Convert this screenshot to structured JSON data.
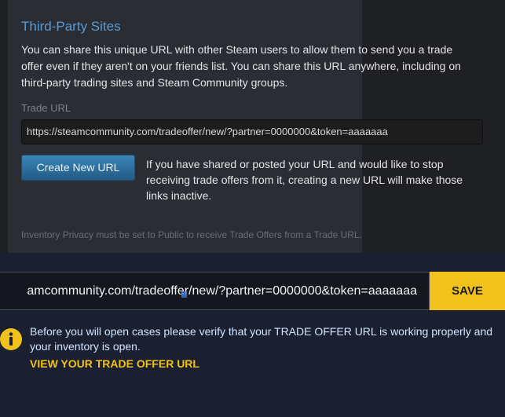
{
  "steam": {
    "section_title": "Third-Party Sites",
    "description": "You can share this unique URL with other Steam users to allow them to send you a trade offer even if they aren't on your friends list. You can share this URL anywhere, including on third-party trading sites and Steam Community groups.",
    "trade_url_label": "Trade URL",
    "trade_url_value": "https://steamcommunity.com/tradeoffer/new/?partner=0000000&token=aaaaaaa",
    "create_button": "Create New URL",
    "create_note": "If you have shared or posted your URL and would like to stop receiving trade offers from it, creating a new URL will make those links inactive.",
    "privacy_note": "Inventory Privacy must be set to Public to receive Trade Offers from a Trade URL."
  },
  "site": {
    "url_value_visible": "amcommunity.com/tradeoffer/new/?partner=0000000&token=aaaaaaa",
    "save_button": "SAVE",
    "info_icon": "info-icon",
    "warning": "Before you will open cases please verify that your TRADE OFFER URL is working properly and your inventory is open.",
    "view_link": "VIEW YOUR TRADE OFFER URL"
  },
  "colors": {
    "accent_yellow": "#f1c21b",
    "steam_blue": "#5a9cd6"
  }
}
